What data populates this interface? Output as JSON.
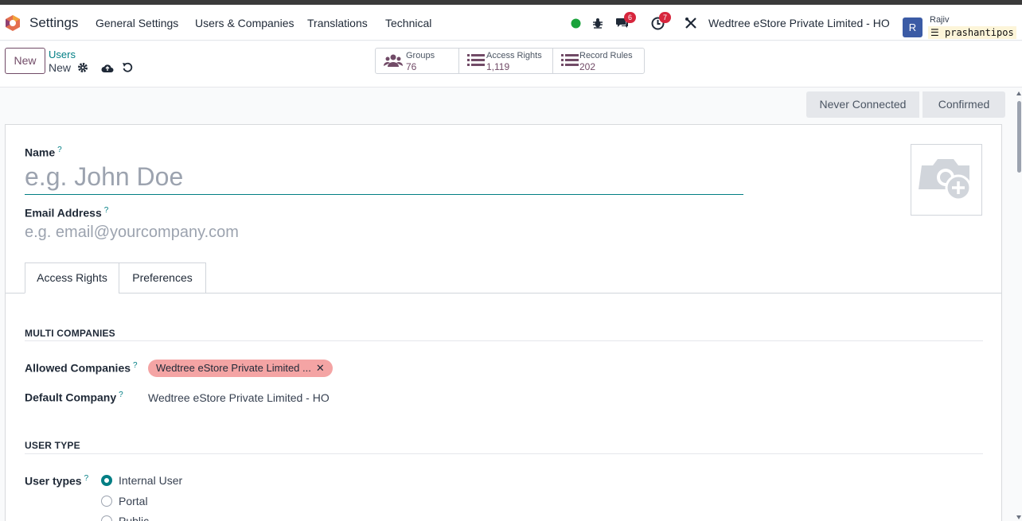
{
  "navbar": {
    "app_name": "Settings",
    "menu": [
      "General Settings",
      "Users & Companies",
      "Translations",
      "Technical"
    ],
    "chat_count": "6",
    "activity_count": "7",
    "company": "Wedtree eStore Private Limited - HO",
    "avatar_initial": "R",
    "user_name": "Rajiv",
    "db_name": "prashantipos",
    "status_color": "#1aa33b"
  },
  "control": {
    "new_label": "New",
    "breadcrumb_parent": "Users",
    "breadcrumb_current": "New",
    "smart_buttons": [
      {
        "label": "Groups",
        "value": "76",
        "icon": "users-icon"
      },
      {
        "label": "Access Rights",
        "value": "1,119",
        "icon": "list-icon"
      },
      {
        "label": "Record Rules",
        "value": "202",
        "icon": "list-icon"
      }
    ]
  },
  "status": {
    "stages": [
      "Never Connected",
      "Confirmed"
    ]
  },
  "form": {
    "name_label": "Name",
    "help_mark": "?",
    "name_placeholder": "e.g. John Doe",
    "email_label": "Email Address",
    "email_placeholder": "e.g. email@yourcompany.com",
    "tabs": [
      "Access Rights",
      "Preferences"
    ],
    "multi_companies_title": "MULTI COMPANIES",
    "allowed_companies_label": "Allowed Companies",
    "allowed_company_tag": "Wedtree eStore Private Limited ...",
    "tag_color": "#f4a4a4",
    "default_company_label": "Default Company",
    "default_company_value": "Wedtree eStore Private Limited - HO",
    "user_type_title": "USER TYPE",
    "user_types_label": "User types",
    "user_type_options": [
      "Internal User",
      "Portal",
      "Public"
    ],
    "selected_user_type": "Internal User",
    "accent_color": "#017e84"
  }
}
